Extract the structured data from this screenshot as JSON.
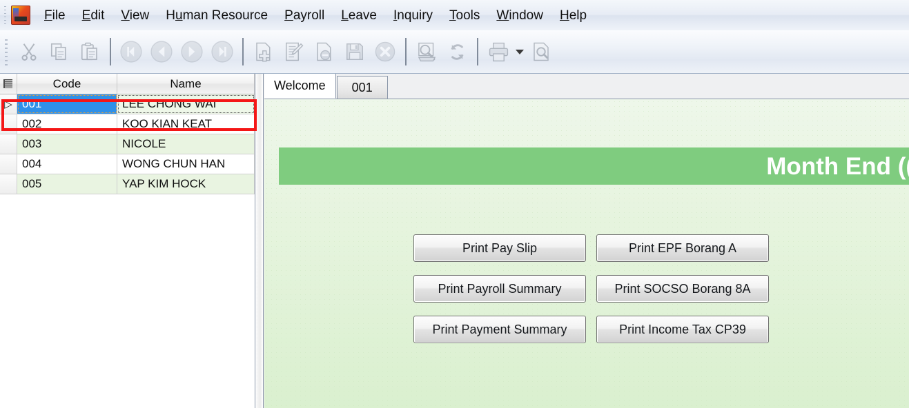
{
  "menubar": {
    "app_icon": "app-logo-icon",
    "items": [
      {
        "label": "File",
        "accel": "F"
      },
      {
        "label": "Edit",
        "accel": "E"
      },
      {
        "label": "View",
        "accel": "V"
      },
      {
        "label": "Human Resource",
        "accel": "u"
      },
      {
        "label": "Payroll",
        "accel": "P"
      },
      {
        "label": "Leave",
        "accel": "L"
      },
      {
        "label": "Inquiry",
        "accel": "I"
      },
      {
        "label": "Tools",
        "accel": "T"
      },
      {
        "label": "Window",
        "accel": "W"
      },
      {
        "label": "Help",
        "accel": "H"
      }
    ]
  },
  "toolbar": {
    "buttons": [
      {
        "name": "cut-icon",
        "label": "Cut",
        "enabled": false
      },
      {
        "name": "copy-icon",
        "label": "Copy",
        "enabled": false
      },
      {
        "name": "paste-icon",
        "label": "Paste",
        "enabled": false
      },
      {
        "name": "first-record-icon",
        "label": "First",
        "enabled": false
      },
      {
        "name": "previous-record-icon",
        "label": "Previous",
        "enabled": false
      },
      {
        "name": "next-record-icon",
        "label": "Next",
        "enabled": false
      },
      {
        "name": "last-record-icon",
        "label": "Last",
        "enabled": false
      },
      {
        "name": "new-record-icon",
        "label": "New",
        "enabled": false
      },
      {
        "name": "edit-record-icon",
        "label": "Edit",
        "enabled": false
      },
      {
        "name": "delete-record-icon",
        "label": "Delete",
        "enabled": false
      },
      {
        "name": "save-icon",
        "label": "Save",
        "enabled": false
      },
      {
        "name": "cancel-icon",
        "label": "Cancel",
        "enabled": false
      },
      {
        "name": "search-icon",
        "label": "Search",
        "enabled": false
      },
      {
        "name": "refresh-icon",
        "label": "Refresh",
        "enabled": false
      },
      {
        "name": "print-icon",
        "label": "Print",
        "enabled": false
      },
      {
        "name": "print-dropdown-caret-icon",
        "label": "Print Options",
        "enabled": false
      },
      {
        "name": "print-preview-icon",
        "label": "Print Preview",
        "enabled": false
      }
    ]
  },
  "grid": {
    "columns": [
      "Code",
      "Name"
    ],
    "rows": [
      {
        "indicator": "▷",
        "code": "001",
        "name": "LEE CHONG WAI",
        "selected": true
      },
      {
        "indicator": "",
        "code": "002",
        "name": "KOO KIAN KEAT",
        "selected": false
      },
      {
        "indicator": "",
        "code": "003",
        "name": "NICOLE",
        "selected": false
      },
      {
        "indicator": "",
        "code": "004",
        "name": "WONG CHUN HAN",
        "selected": false
      },
      {
        "indicator": "",
        "code": "005",
        "name": "YAP KIM HOCK",
        "selected": false
      }
    ]
  },
  "tabs": [
    {
      "label": "Welcome",
      "active": true
    },
    {
      "label": "001",
      "active": false
    }
  ],
  "content": {
    "banner_title": "Month End ((",
    "banner_color": "#7fcc7f",
    "buttons": [
      "Print Pay Slip",
      "Print EPF Borang A",
      "Print Payroll Summary",
      "Print SOCSO Borang 8A",
      "Print Payment Summary",
      "Print Income Tax CP39"
    ]
  },
  "annotation": {
    "color": "#f41616",
    "target": "selected-employee-row"
  }
}
